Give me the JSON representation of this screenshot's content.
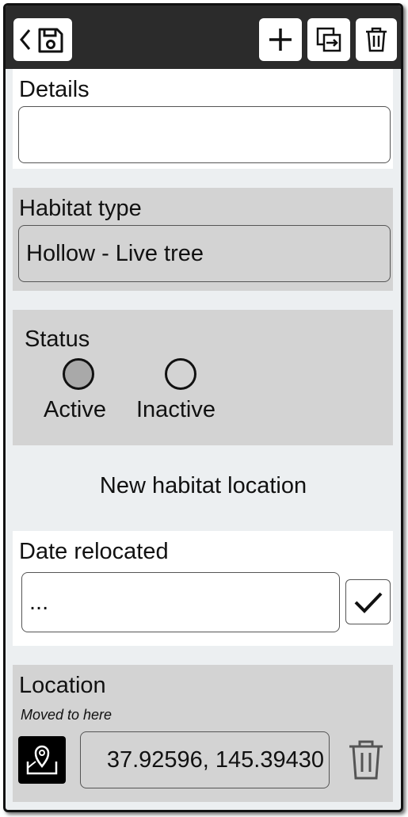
{
  "toolbar": {
    "back_icon": "chevron-left-icon",
    "save_icon": "save-icon",
    "add_icon": "plus-icon",
    "copy_icon": "copy-icon",
    "delete_icon": "trash-icon"
  },
  "details": {
    "label": "Details",
    "value": ""
  },
  "habitat_type": {
    "label": "Habitat type",
    "value": "Hollow - Live tree"
  },
  "status": {
    "label": "Status",
    "options": [
      "Active",
      "Inactive"
    ],
    "selected": "Active"
  },
  "new_location": {
    "title": "New habitat location"
  },
  "date_relocated": {
    "label": "Date relocated",
    "value": "...",
    "confirm_icon": "checkmark-icon"
  },
  "location": {
    "label": "Location",
    "sublabel": "Moved to here",
    "value": "37.92596, 145.39430",
    "map_icon": "map-pin-icon",
    "delete_icon": "trash-icon"
  },
  "colors": {
    "topbar": "#2b2b2b",
    "background": "#eceff1",
    "grey_card": "#d3d3d3",
    "radio_selected": "#a9a9a9"
  }
}
